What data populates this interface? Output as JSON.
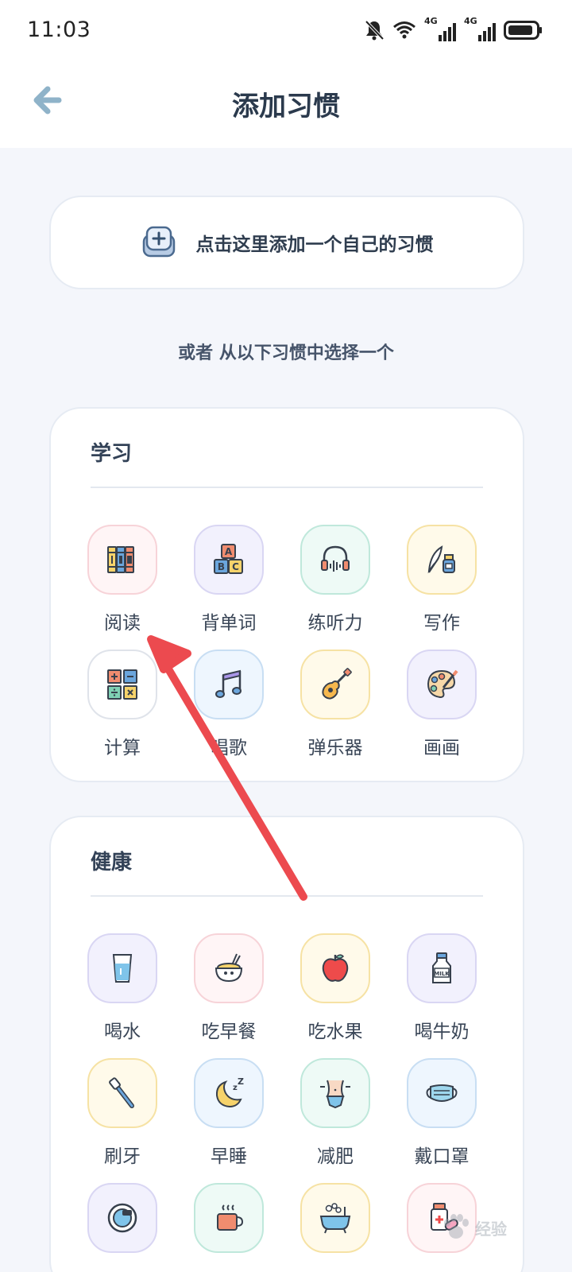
{
  "status": {
    "time": "11:03",
    "network_1": "4G",
    "network_2": "4G"
  },
  "header": {
    "title": "添加习惯"
  },
  "custom": {
    "label": "点击这里添加一个自己的习惯"
  },
  "choose_hint": "或者 从以下习惯中选择一个",
  "sections": [
    {
      "title": "学习",
      "items": [
        {
          "label": "阅读",
          "icon": "books-icon"
        },
        {
          "label": "背单词",
          "icon": "abc-blocks-icon"
        },
        {
          "label": "练听力",
          "icon": "headphones-icon"
        },
        {
          "label": "写作",
          "icon": "quill-ink-icon"
        },
        {
          "label": "计算",
          "icon": "calculator-icon"
        },
        {
          "label": "唱歌",
          "icon": "music-note-icon"
        },
        {
          "label": "弹乐器",
          "icon": "guitar-icon"
        },
        {
          "label": "画画",
          "icon": "palette-icon"
        }
      ]
    },
    {
      "title": "健康",
      "items": [
        {
          "label": "喝水",
          "icon": "water-glass-icon"
        },
        {
          "label": "吃早餐",
          "icon": "breakfast-bowl-icon"
        },
        {
          "label": "吃水果",
          "icon": "apple-icon"
        },
        {
          "label": "喝牛奶",
          "icon": "milk-bottle-icon"
        },
        {
          "label": "刷牙",
          "icon": "toothbrush-icon"
        },
        {
          "label": "早睡",
          "icon": "moon-sleep-icon"
        },
        {
          "label": "减肥",
          "icon": "waist-icon"
        },
        {
          "label": "戴口罩",
          "icon": "mask-icon"
        },
        {
          "label": "",
          "icon": "scale-icon"
        },
        {
          "label": "",
          "icon": "hot-cup-icon"
        },
        {
          "label": "",
          "icon": "bathtub-icon"
        },
        {
          "label": "",
          "icon": "medicine-icon"
        }
      ]
    }
  ],
  "watermark": {
    "text": "经验"
  },
  "colors": {
    "tile_pink": "#ffe4e8",
    "tile_purple": "#ebe9fb",
    "tile_mint": "#dcf5ee",
    "tile_yellow": "#fff3cf",
    "tile_blue": "#e3f0fc",
    "tile_white": "#ffffff",
    "arrow_red": "#ec4a4f",
    "accent_blue": "#6e97c4"
  }
}
